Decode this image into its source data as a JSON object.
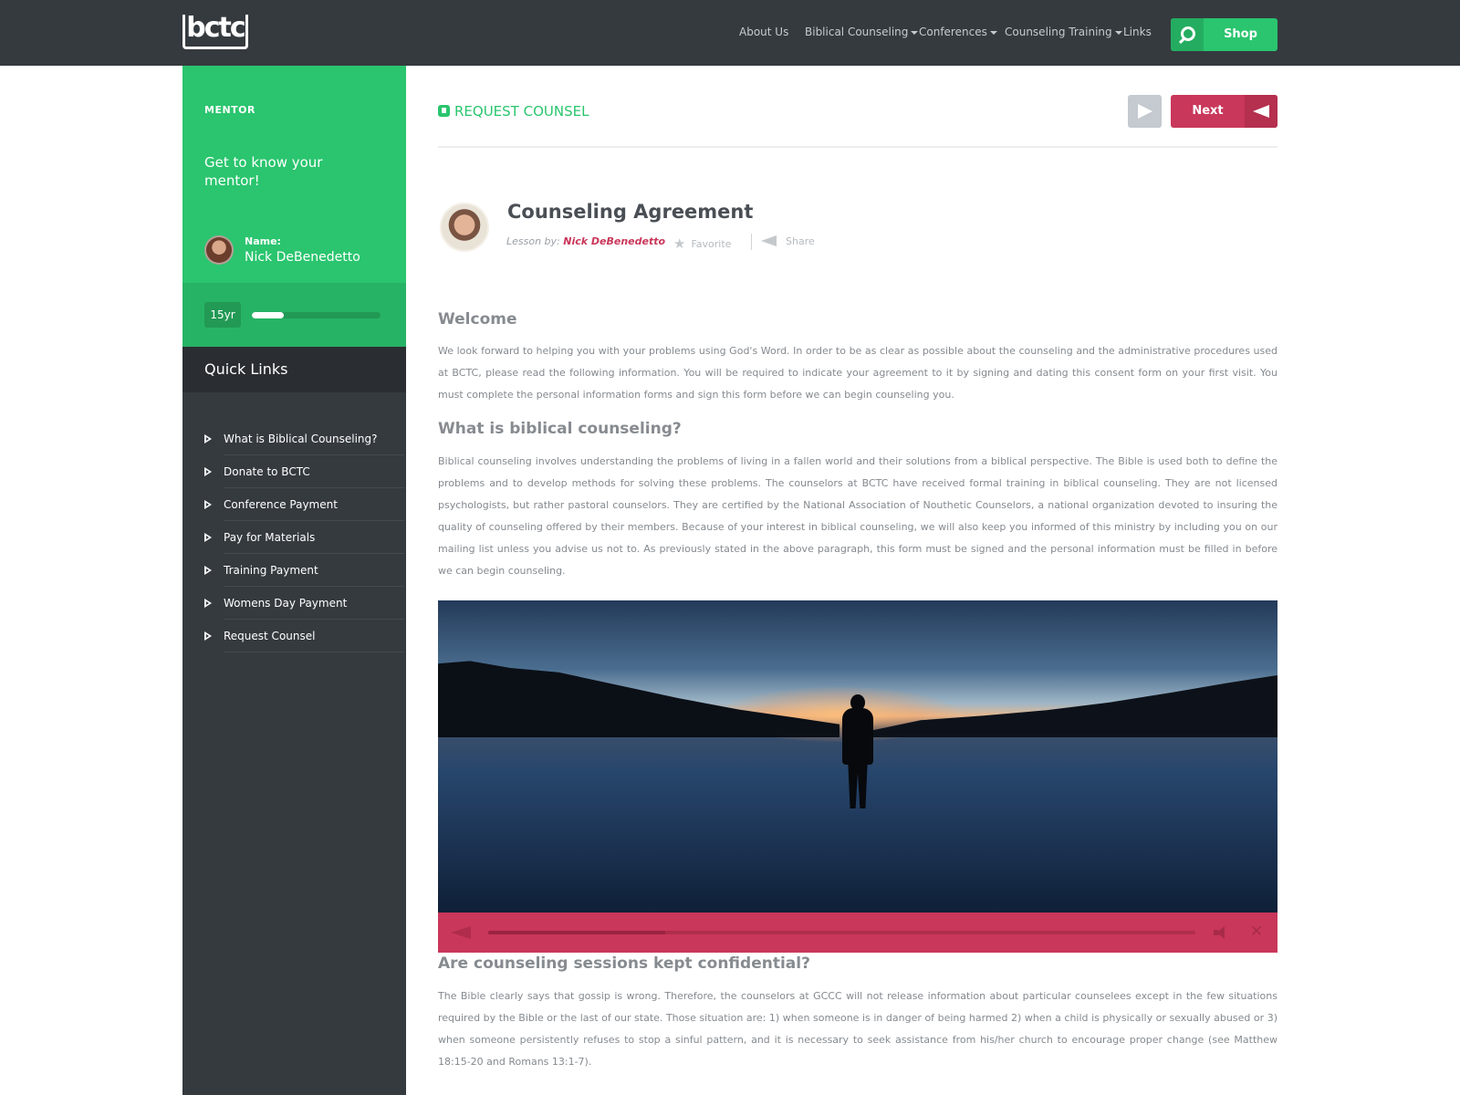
{
  "header": {
    "logo_text": "bctc",
    "nav": [
      {
        "label": "About Us",
        "has_caret": false
      },
      {
        "label": "Biblical Counseling",
        "has_caret": true
      },
      {
        "label": "Conferences",
        "has_caret": true
      },
      {
        "label": "Counseling Training",
        "has_caret": true
      },
      {
        "label": "Links",
        "has_caret": false
      }
    ],
    "search_icon": "search-icon",
    "shop_label": "Shop"
  },
  "sidebar": {
    "mentor_label": "MENTOR",
    "mentor_tagline": "Get to know your mentor!",
    "name_label": "Name:",
    "mentor_name": "Nick DeBenedetto",
    "experience_badge": "15yr",
    "experience_progress_pct": 25,
    "quick_links_title": "Quick Links",
    "quick_links": [
      {
        "label": "What is Biblical Counseling?"
      },
      {
        "label": "Donate to BCTC"
      },
      {
        "label": "Conference Payment"
      },
      {
        "label": "Pay for Materials"
      },
      {
        "label": "Training Payment"
      },
      {
        "label": "Womens Day Payment"
      },
      {
        "label": "Request Counsel"
      }
    ]
  },
  "main": {
    "breadcrumb": "REQUEST COUNSEL",
    "next_label": "Next",
    "lesson": {
      "title": "Counseling Agreement",
      "by_label": "Lesson by:",
      "author": "Nick DeBenedetto",
      "favorite_label": "Favorite",
      "share_label": "Share"
    },
    "sections": [
      {
        "heading": "Welcome",
        "body": "We look forward to helping you with your problems using God's Word.  In order to be as clear as possible about the counseling and the administrative procedures used at BCTC, please read the following information. You will be required to indicate your agreement to it by signing and dating this consent form on your first visit. You must complete the personal information forms and sign this form before we can begin counseling you."
      },
      {
        "heading": "What is biblical counseling?",
        "body": "Biblical counseling involves understanding the problems of living in a fallen world and their solutions from a biblical perspective.  The Bible is used both to define the problems and to develop methods for solving these problems.  The counselors at BCTC have received formal training in biblical counseling.  They are not licensed psychologists, but rather pastoral counselors.  They are certified by the National Association of Nouthetic Counselors, a national organization devoted to insuring the quality of counseling offered by their members.  Because of your interest in biblical counseling, we will also keep you informed of this ministry by including you on our mailing list unless you advise us not to.  As previously stated in the above paragraph, this form must be signed and the personal information must be filled in before we can begin counseling."
      },
      {
        "heading": "Are counseling sessions kept confidential?",
        "body": "The Bible clearly says that gossip is wrong.  Therefore, the counselors at GCCC will not release information about particular counselees except in the few situations required by the Bible or the last of our state.  Those situation are: 1) when someone is in danger of being harmed 2) when a child is physically or sexually abused or 3) when someone persistently refuses to stop a sinful pattern, and it is necessary to seek assistance from his/her church to encourage proper change (see Matthew 18:15-20 and Romans 13:1-7)."
      }
    ],
    "video": {
      "progress_pct": 25,
      "controls_color": "#c9375a"
    }
  },
  "colors": {
    "brand_green": "#2ac56e",
    "accent_red": "#c9375a",
    "dark": "#353a3f"
  }
}
